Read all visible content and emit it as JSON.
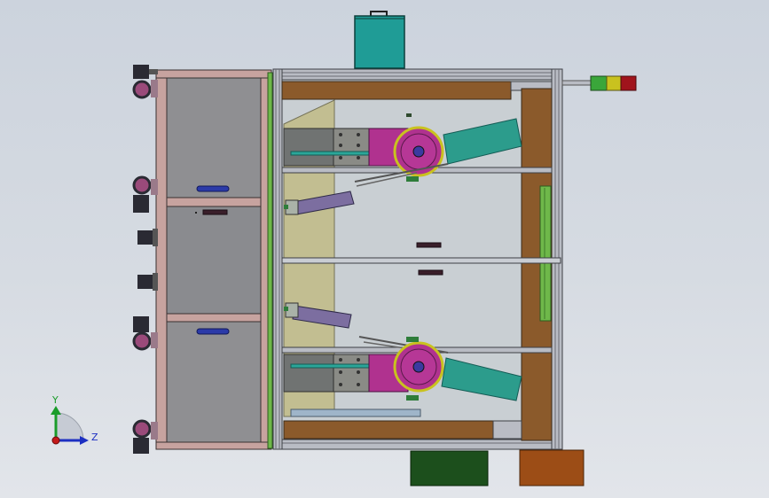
{
  "view": {
    "background_top": "#ccd3dd",
    "background_bottom": "#e2e5ea"
  },
  "triad": {
    "y_label": "Y",
    "z_label": "Z",
    "y_color": "#1a9c2a",
    "z_color": "#1c2fc2",
    "x_color": "#c41a1a"
  },
  "colors": {
    "frame_pink": "#c9a5a1",
    "panel_gray": "#8f8f92",
    "panel_gray_dark": "#7d7e82",
    "aluminum": "#b9bcc4",
    "wood": "#8b5a2b",
    "wood_light": "#9a6a3a",
    "teal_box": "#1f9c96",
    "olive": "#c2bd8a",
    "magenta": "#b0328f",
    "green_plate": "#2e7d3a",
    "green_light": "#7fb069",
    "dark_green_box": "#1c4f1c",
    "brown_box": "#9c4d16",
    "light_green_rail": "#6fb84a",
    "tower_green": "#3aa63a",
    "tower_yellow": "#c9c21f",
    "tower_red": "#a0141c",
    "handle_blue": "#2b3aa8",
    "caster_dark": "#2a2a33",
    "caster_pink": "#9a4a7a"
  }
}
